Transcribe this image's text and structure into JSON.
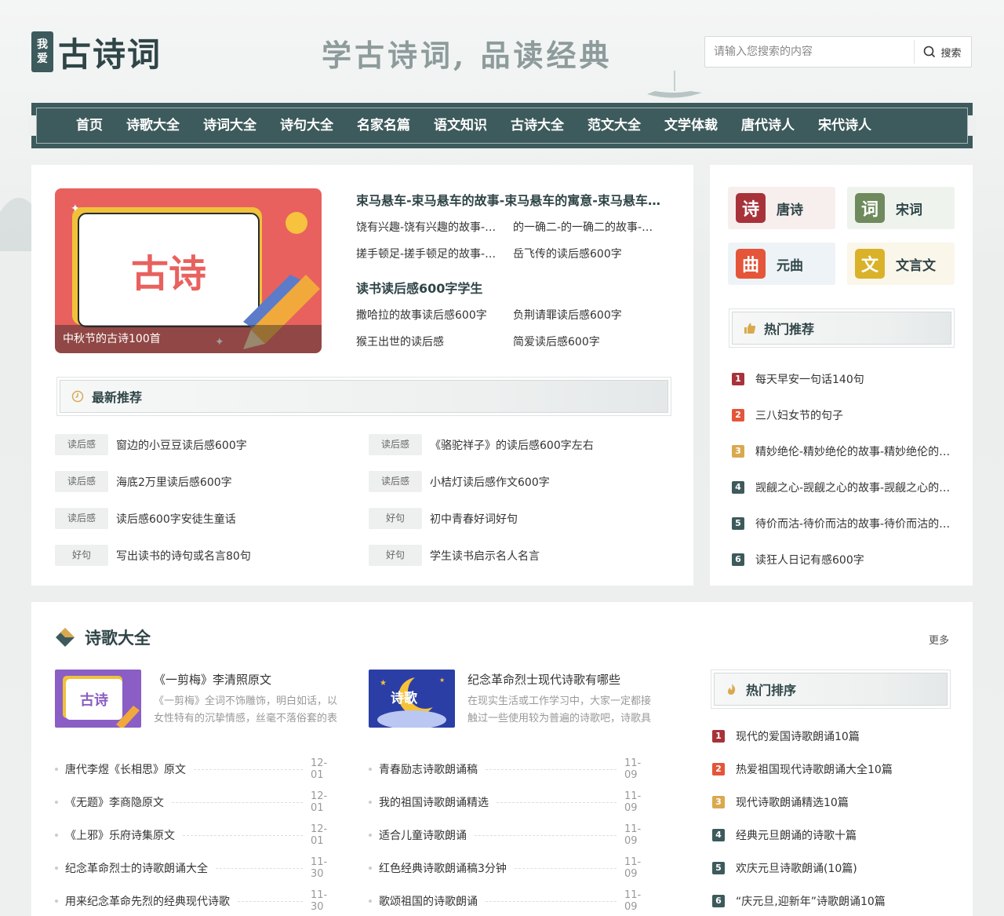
{
  "header": {
    "logo_seal_1": "我",
    "logo_seal_2": "爱",
    "logo_text": "古诗词",
    "slogan": "学古诗词, 品读经典",
    "search_placeholder": "请输入您搜索的内容",
    "search_button": "搜索"
  },
  "nav": {
    "items": [
      "首页",
      "诗歌大全",
      "诗词大全",
      "诗句大全",
      "名家名篇",
      "语文知识",
      "古诗大全",
      "范文大全",
      "文学体裁",
      "唐代诗人",
      "宋代诗人"
    ]
  },
  "featured": {
    "image_text": "古诗",
    "caption": "中秋节的古诗100首",
    "title_1": "束马悬车-束马悬车的故事-束马悬车的寓意-束马悬车的意思",
    "rows_1": [
      [
        "饶有兴趣-饶有兴趣的故事-饶有兴趣的寓意",
        "的一确二-的一确二的故事-的一确二的寓意"
      ],
      [
        "搓手顿足-搓手顿足的故事-搓手顿足的寓意",
        "岳飞传的读后感600字"
      ]
    ],
    "title_2": "读书读后感600字学生",
    "rows_2": [
      [
        "撒哈拉的故事读后感600字",
        "负荆请罪读后感600字"
      ],
      [
        "猴王出世的读后感",
        "简爱读后感600字"
      ]
    ]
  },
  "latest": {
    "title": "最新推荐",
    "rows": [
      [
        {
          "tag": "读后感",
          "text": "窗边的小豆豆读后感600字"
        },
        {
          "tag": "读后感",
          "text": "《骆驼祥子》的读后感600字左右"
        }
      ],
      [
        {
          "tag": "读后感",
          "text": "海底2万里读后感600字"
        },
        {
          "tag": "读后感",
          "text": "小桔灯读后感作文600字"
        }
      ],
      [
        {
          "tag": "读后感",
          "text": "读后感600字安徒生童话"
        },
        {
          "tag": "好句",
          "text": "初中青春好词好句"
        }
      ],
      [
        {
          "tag": "好句",
          "text": "写出读书的诗句或名言80句"
        },
        {
          "tag": "好句",
          "text": "学生读书启示名人名言"
        }
      ]
    ]
  },
  "categories": [
    {
      "icon": "诗",
      "label": "唐诗"
    },
    {
      "icon": "词",
      "label": "宋词"
    },
    {
      "icon": "曲",
      "label": "元曲"
    },
    {
      "icon": "文",
      "label": "文言文"
    }
  ],
  "hot": {
    "title": "热门推荐",
    "items": [
      "每天早安一句话140句",
      "三八妇女节的句子",
      "精妙绝伦-精妙绝伦的故事-精妙绝伦的寓意",
      "觊觎之心-觊觎之心的故事-觊觎之心的寓意",
      "待价而沽-待价而沽的故事-待价而沽的寓意",
      "读狂人日记有感600字"
    ]
  },
  "poetry": {
    "title": "诗歌大全",
    "more": "更多",
    "cards": [
      {
        "thumb_text": "古诗",
        "title": "《一剪梅》李清照原文",
        "desc": "《一剪梅》全词不饰雕饰，明白如话，以女性特有的沉挚情感，丝毫不落俗套的表现手法"
      },
      {
        "thumb_text": "诗歌",
        "title": "纪念革命烈士现代诗歌有哪些",
        "desc": "在现实生活或工作学习中，大家一定都接触过一些使用较为普遍的诗歌吧，诗歌具有凝练的语言"
      }
    ],
    "list_left": [
      {
        "text": "唐代李煜《长相思》原文",
        "date": "12-01"
      },
      {
        "text": "《无题》李商隐原文",
        "date": "12-01"
      },
      {
        "text": "《上邪》乐府诗集原文",
        "date": "12-01"
      },
      {
        "text": "纪念革命烈士的诗歌朗诵大全",
        "date": "11-30"
      },
      {
        "text": "用来纪念革命先烈的经典现代诗歌",
        "date": "11-30"
      }
    ],
    "list_right": [
      {
        "text": "青春励志诗歌朗诵稿",
        "date": "11-09"
      },
      {
        "text": "我的祖国诗歌朗诵精选",
        "date": "11-09"
      },
      {
        "text": "适合儿童诗歌朗诵",
        "date": "11-09"
      },
      {
        "text": "红色经典诗歌朗诵稿3分钟",
        "date": "11-09"
      },
      {
        "text": "歌颂祖国的诗歌朗诵",
        "date": "11-09"
      }
    ],
    "rank_title": "热门排序",
    "rank": [
      "现代的爱国诗歌朗诵10篇",
      "热爱祖国现代诗歌朗诵大全10篇",
      "现代诗歌朗诵精选10篇",
      "经典元旦朗诵的诗歌十篇",
      "欢庆元旦诗歌朗诵(10篇)",
      "“庆元旦,迎新年”诗歌朗诵10篇"
    ]
  },
  "colors": {
    "brand": "#3d5a5c",
    "rank_1": "#a8323a",
    "rank_2": "#e4553a",
    "rank_3": "#d9a94f",
    "rank_4": "#3d5a5c"
  }
}
